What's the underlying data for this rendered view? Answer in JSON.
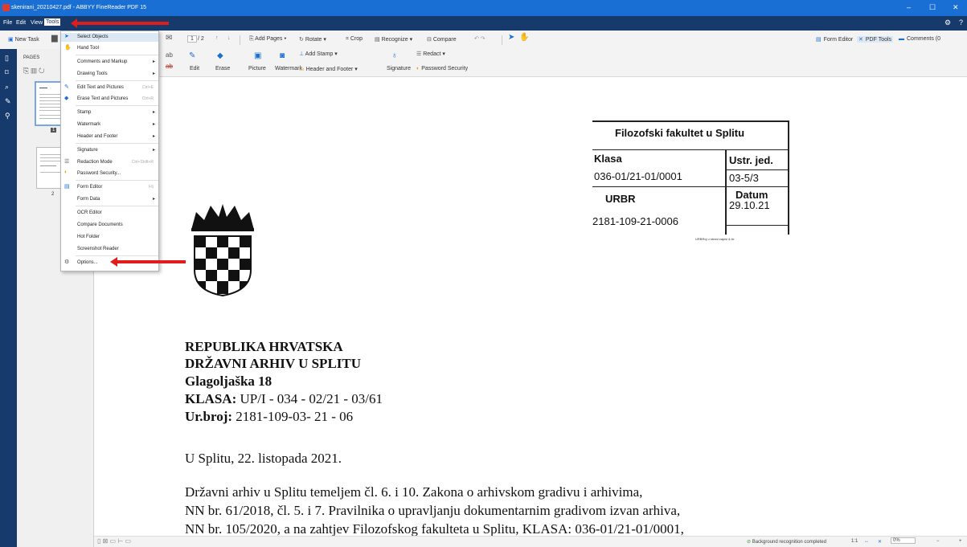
{
  "window": {
    "title": "skenirani_20210427.pdf - ABBYY FineReader PDF 15",
    "controls": [
      "–",
      "☐",
      "✕"
    ]
  },
  "menubar": {
    "items": [
      "File",
      "Edit",
      "View",
      "Tools"
    ]
  },
  "toolbar": {
    "new_task": "New Task",
    "page_current": "1",
    "page_total": "/ 2",
    "add_pages": "Add Pages ▾",
    "rotate": "Rotate ▾",
    "crop": "Crop",
    "recognize": "Recognize ▾",
    "compare": "Compare",
    "add_stamp": "Add Stamp ▾",
    "redact": "Redact ▾",
    "edit": "Edit",
    "erase": "Erase",
    "picture": "Picture",
    "watermark": "Watermark",
    "header_footer": "Header and Footer ▾",
    "signature": "Signature",
    "password_security": "Password Security",
    "form_editor": "Form Editor",
    "pdf_tools": "PDF Tools",
    "comments": "Comments (0"
  },
  "pages_panel": {
    "title": "PAGES",
    "page1_label": "1",
    "page2_label": "2"
  },
  "tools_menu": {
    "items": [
      {
        "label": "Select Objects",
        "icon": "cursor-icon",
        "shortcut": "",
        "submenu": false
      },
      {
        "label": "Hand Tool",
        "icon": "hand-icon",
        "shortcut": "",
        "submenu": false
      },
      {
        "label": "Comments and Markup",
        "icon": "",
        "shortcut": "",
        "submenu": true
      },
      {
        "label": "Drawing Tools",
        "icon": "",
        "shortcut": "",
        "submenu": true
      },
      {
        "label": "Edit Text and Pictures",
        "icon": "edit-icon",
        "shortcut": "Ctrl+E",
        "submenu": false
      },
      {
        "label": "Erase Text and Pictures",
        "icon": "eraser-icon",
        "shortcut": "Ctrl+R",
        "submenu": false
      },
      {
        "label": "Stamp",
        "icon": "",
        "shortcut": "",
        "submenu": true
      },
      {
        "label": "Watermark",
        "icon": "",
        "shortcut": "",
        "submenu": true
      },
      {
        "label": "Header and Footer",
        "icon": "",
        "shortcut": "",
        "submenu": true
      },
      {
        "label": "Signature",
        "icon": "",
        "shortcut": "",
        "submenu": true
      },
      {
        "label": "Redaction Mode",
        "icon": "redact-icon",
        "shortcut": "Ctrl+Shift+R",
        "submenu": false
      },
      {
        "label": "Password Security...",
        "icon": "shield-icon",
        "shortcut": "",
        "submenu": false
      },
      {
        "label": "Form Editor",
        "icon": "form-icon",
        "shortcut": "F6",
        "submenu": false
      },
      {
        "label": "Form Data",
        "icon": "",
        "shortcut": "",
        "submenu": true
      },
      {
        "label": "OCR Editor",
        "icon": "",
        "shortcut": "",
        "submenu": false
      },
      {
        "label": "Compare Documents",
        "icon": "",
        "shortcut": "",
        "submenu": false
      },
      {
        "label": "Hot Folder",
        "icon": "",
        "shortcut": "",
        "submenu": false
      },
      {
        "label": "Screenshot Reader",
        "icon": "",
        "shortcut": "",
        "submenu": false
      },
      {
        "label": "Options...",
        "icon": "gear-icon",
        "shortcut": "",
        "submenu": false
      }
    ]
  },
  "document": {
    "stamp": {
      "header": "Filozofski fakultet u Splitu",
      "klasa_label": "Klasa",
      "ustr_label": "Ustr. jed.",
      "klasa_value": "036-01/21-01/0001",
      "ustr_value": "03-5/3",
      "urbr_label": "URBR",
      "datum_label": "Datum",
      "datum_value": "29.10.21",
      "urbr_value": "2181-109-21-0006",
      "footer_tiny": "URBRoj u strani zapisi & br."
    },
    "letter": {
      "line1": "REPUBLIKA HRVATSKA",
      "line2": "DRŽAVNI ARHIV U SPLITU",
      "line3": "Glagoljaška 18",
      "klasa_label": "KLASA:",
      "klasa_value": " UP/I - 034 - 02/21 - 03/61",
      "urbroj_label": "Ur.broj:",
      "urbroj_value": " 2181-109-03- 21 - 06",
      "place_date": "U Splitu, 22. listopada 2021.",
      "body1": "Državni arhiv u Splitu temeljem čl. 6. i 10. Zakona o arhivskom gradivu i arhivima,",
      "body2": "NN br. 61/2018,  čl. 5. i  7. Pravilnika o upravljanju dokumentarnim gradivom izvan arhiva,",
      "body3": "NN br. 105/2020, a na zahtjev Filozofskog fakulteta u Splitu, KLASA: 036-01/21-01/0001,"
    }
  },
  "statusbar": {
    "status": "Background recognition completed",
    "ratio": "1:1",
    "zoom": "0%"
  },
  "colors": {
    "titlebar": "#1a6fd4",
    "menubar": "#153a6b",
    "annotation_arrow": "#e21b1b"
  }
}
